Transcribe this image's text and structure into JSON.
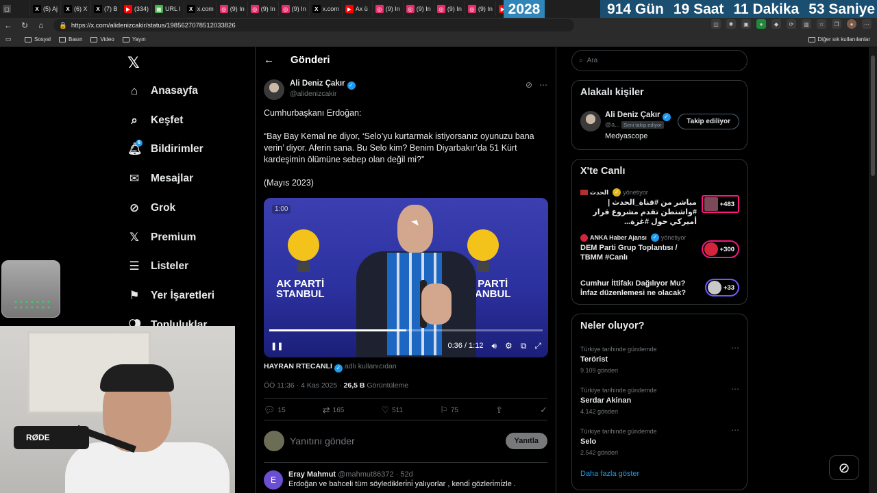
{
  "browser": {
    "tabs": [
      {
        "label": "(5) Aj",
        "icon": "x-icon",
        "color": "#000000"
      },
      {
        "label": "(6) X",
        "icon": "x-icon",
        "color": "#000000"
      },
      {
        "label": "(7) B",
        "icon": "x-icon",
        "color": "#000000"
      },
      {
        "label": "(334)",
        "icon": "youtube-icon",
        "color": "#ff0000"
      },
      {
        "label": "URL I",
        "icon": "generic-icon",
        "color": "#4caf50"
      },
      {
        "label": "x.com",
        "icon": "x-icon",
        "color": "#000000"
      },
      {
        "label": "(9) In",
        "icon": "instagram-icon",
        "color": "#e1306c"
      },
      {
        "label": "(9) In",
        "icon": "instagram-icon",
        "color": "#e1306c"
      },
      {
        "label": "(9) In",
        "icon": "instagram-icon",
        "color": "#e1306c"
      },
      {
        "label": "x.com",
        "icon": "x-icon",
        "color": "#000000"
      },
      {
        "label": "Ax ü",
        "icon": "youtube-icon",
        "color": "#ff0000"
      },
      {
        "label": "(9) In",
        "icon": "instagram-icon",
        "color": "#e1306c"
      },
      {
        "label": "(9) In",
        "icon": "instagram-icon",
        "color": "#e1306c"
      },
      {
        "label": "(9) In",
        "icon": "instagram-icon",
        "color": "#e1306c"
      },
      {
        "label": "(9) In",
        "icon": "instagram-icon",
        "color": "#e1306c"
      },
      {
        "label": "U",
        "icon": "youtube-icon",
        "color": "#ff0000"
      }
    ],
    "countdown": {
      "year": "2028",
      "days": "914 Gün",
      "hours": "19 Saat",
      "minutes": "11 Dakika",
      "seconds": "53 Saniye"
    },
    "url": "https://x.com/alidenizcakir/status/1985627078512033826",
    "bookmarks": [
      "Sosyal",
      "Basın",
      "Video",
      "Yayın"
    ],
    "bookmarks_other": "Diğer sık kullanılanlar"
  },
  "sidebar": {
    "items": [
      {
        "label": "Anasayfa",
        "icon": "home-icon"
      },
      {
        "label": "Keşfet",
        "icon": "search-icon"
      },
      {
        "label": "Bildirimler",
        "icon": "bell-icon"
      },
      {
        "label": "Mesajlar",
        "icon": "mail-icon"
      },
      {
        "label": "Grok",
        "icon": "grok-icon"
      },
      {
        "label": "Premium",
        "icon": "x-premium-icon"
      },
      {
        "label": "Listeler",
        "icon": "list-icon"
      },
      {
        "label": "Yer İşaretleri",
        "icon": "bookmark-icon"
      },
      {
        "label": "Topluluklar",
        "icon": "communities-icon"
      }
    ],
    "notification_badge": "6"
  },
  "main": {
    "header_title": "Gönderi",
    "post": {
      "author_name": "Ali Deniz Çakır",
      "author_handle": "@alidenizcakir",
      "text": [
        "Cumhurbaşkanı Erdoğan:",
        "“Bay Bay Kemal ne diyor, ‘Selo’yu kurtarmak istiyorsanız oyunuzu bana verin’ diyor. Aferin sana. Bu Selo kim? Benim Diyarbakır’da 51 Kürt kardeşimin ölümüne sebep olan değil mi?”",
        "(Mayıs 2023)"
      ],
      "video": {
        "badge": "1:00",
        "time": "0:36 / 1:12",
        "progress": 0.5,
        "banner_left": "AK PARTİ\nSTANBUL",
        "banner_right": "PARTİ\nANBUL"
      },
      "credit_name": "HAYRAN RTECANLI",
      "credit_suffix": "adlı kullanıcıdan",
      "time": "ÖÖ 11:36 · 4 Kas 2025 ·",
      "views": "26,5 B",
      "views_label": "Görüntüleme",
      "stats": {
        "replies": "15",
        "reposts": "165",
        "likes": "511",
        "bookmarks": "75"
      }
    },
    "reply_placeholder": "Yanıtını gönder",
    "reply_button": "Yanıtla",
    "first_reply": {
      "avatar_letter": "E",
      "name": "Eray Mahmut",
      "handle": "@mahmut86372 · 52d",
      "text": "Erdoğan ve bahceli tüm söyledikleri̇ni̇ yalıyorlar , kendi̇ gözleri̇mi̇zle ."
    }
  },
  "right": {
    "search_placeholder": "Ara",
    "related": {
      "title": "Alakalı kişiler",
      "name": "Ali Deniz Çakır",
      "handle": "@a...",
      "follows_you": "Seni takip ediyor",
      "bio": "Medyascope",
      "button": "Takip ediliyor"
    },
    "live": {
      "title": "X'te Canlı",
      "items": [
        {
          "source": "الحدث",
          "status": "yönetiyor",
          "title": "مباشر من #قناة_الحدث | #واشنطن تقدم مشروع قرار أميركي حول #غزة...",
          "count": "+483"
        },
        {
          "source": "ANKA Haber Ajansı",
          "status": "yönetiyor",
          "title": "DEM Parti Grup Toplantısı / TBMM #Canlı",
          "count": "+300"
        },
        {
          "source": "",
          "status": "",
          "title": "Cumhur İttifakı Dağılıyor Mu? İnfaz düzenlemesi ne olacak?",
          "count": "+33"
        }
      ]
    },
    "trends": {
      "title": "Neler oluyor?",
      "items": [
        {
          "context": "Türkiye tarihinde gündemde",
          "name": "Terörist",
          "count": "9.109 gönderi"
        },
        {
          "context": "Türkiye tarihinde gündemde",
          "name": "Serdar Akinan",
          "count": "4.142 gönderi"
        },
        {
          "context": "Türkiye tarihinde gündemde",
          "name": "Selo",
          "count": "2.542 gönderi"
        }
      ],
      "show_more": "Daha fazla göster"
    }
  },
  "overlay": {
    "mic_brand": "RØDE"
  }
}
